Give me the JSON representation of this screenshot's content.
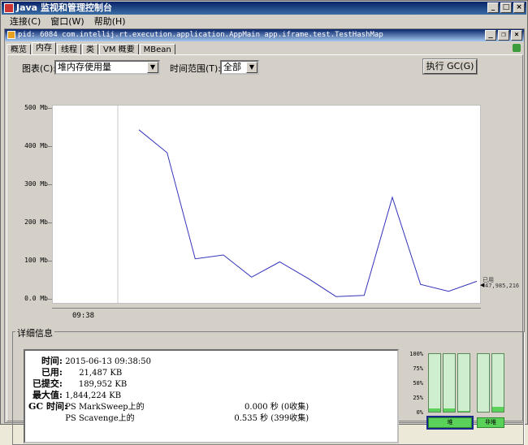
{
  "window": {
    "title": "Java 监视和管理控制台"
  },
  "menu": [
    "连接(C)",
    "窗口(W)",
    "帮助(H)"
  ],
  "inner": {
    "title": "pid: 6084 com.intellij.rt.execution.application.AppMain app.iframe.test.TestHashMap"
  },
  "tabs": [
    "概览",
    "内存",
    "线程",
    "类",
    "VM 概要",
    "MBean"
  ],
  "controls": {
    "chart_label": "图表(C):",
    "chart_value": "堆内存使用量",
    "range_label": "时间范围(T):",
    "range_value": "全部",
    "gc_button": "执行 GC(G)"
  },
  "chart_data": {
    "type": "line",
    "y_ticks": [
      "500 Mb",
      "400 Mb",
      "300 Mb",
      "200 Mb",
      "100 Mb",
      "0.0 Mb"
    ],
    "x_ticks": [
      "09:38"
    ],
    "ylim": [
      0,
      500
    ],
    "series": [
      {
        "values": [
          445,
          385,
          107,
          117,
          59,
          99,
          56,
          8,
          11,
          268,
          40,
          22,
          48
        ]
      }
    ],
    "current_label": "已用",
    "current_value": "47,985,216",
    "line_color": "#3333bb"
  },
  "details": {
    "legend": "详细信息",
    "rows": [
      {
        "label": "时间:",
        "value": "2015-06-13 09:38:50"
      },
      {
        "label": "已用:",
        "value": "21,487 KB"
      },
      {
        "label": "已提交:",
        "value": "189,952 KB"
      },
      {
        "label": "最大值:",
        "value": "1,844,224 KB"
      },
      {
        "label": "GC 时间:",
        "value": "PS MarkSweep上的",
        "extra": "0.000 秒 (0收集)"
      },
      {
        "label": "",
        "value": "PS Scavenge上的",
        "extra": "0.535 秒 (399收集)"
      }
    ]
  },
  "pools": {
    "pct_labels": [
      "100%",
      "75%",
      "50%",
      "25%",
      "0%"
    ],
    "fills": [
      0.05,
      0.05,
      0.02,
      0.0,
      0.08
    ],
    "buttons": [
      "堆",
      "非堆"
    ]
  }
}
